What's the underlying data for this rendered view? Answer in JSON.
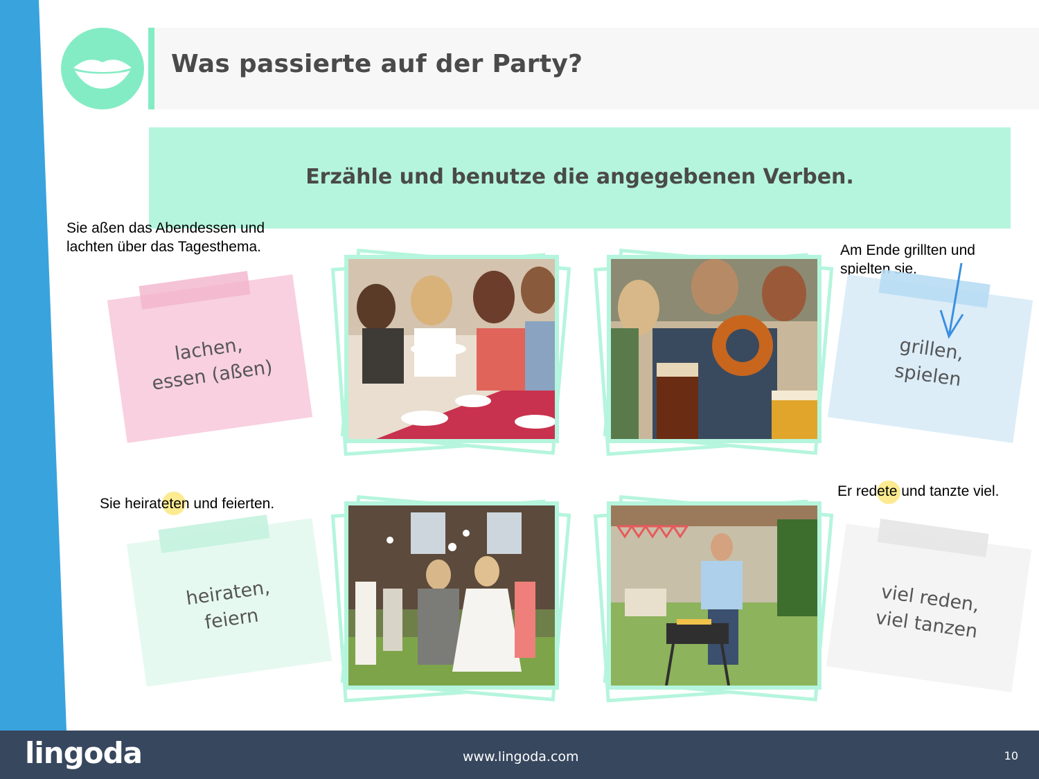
{
  "colors": {
    "side_stripe": "#39a3de",
    "accent_mint": "#84ecc4",
    "instruction_bg": "#b5f5dd",
    "footer_bg": "#37475e",
    "note_pink": "#f8d0e0",
    "note_blue": "#dcedf8",
    "note_mint": "#e6f9f1",
    "note_gray": "#f4f4f4",
    "annotation_arrow": "#3b8fe0",
    "highlight": "#fbe77e"
  },
  "header": {
    "icon": "lips-icon",
    "title": "Was passierte auf der Party?"
  },
  "instruction": "Erzähle und benutze die angegebenen Verben.",
  "annotations": {
    "top_left": "Sie aßen das Abendessen und\nlachten über das Tagesthema.",
    "top_right": "Am Ende grillten und\nspielten sie.",
    "bottom_left": "Sie heirateten und feierten.",
    "bottom_right": "Er redete und tanzte viel."
  },
  "notes": [
    {
      "color": "pink",
      "text": "lachen,\nessen (aßen)"
    },
    {
      "color": "blue",
      "text": "grillen,\nspielen"
    },
    {
      "color": "mint",
      "text": "heiraten,\nfeiern"
    },
    {
      "color": "gray",
      "text": "viel reden,\nviel tanzen"
    }
  ],
  "photos": [
    {
      "subject": "friends-dinner-photo"
    },
    {
      "subject": "pretzel-beer-photo"
    },
    {
      "subject": "wedding-celebration-photo"
    },
    {
      "subject": "garden-barbecue-photo"
    }
  ],
  "footer": {
    "logo": "lingoda",
    "url": "www.lingoda.com",
    "page_number": "10"
  }
}
